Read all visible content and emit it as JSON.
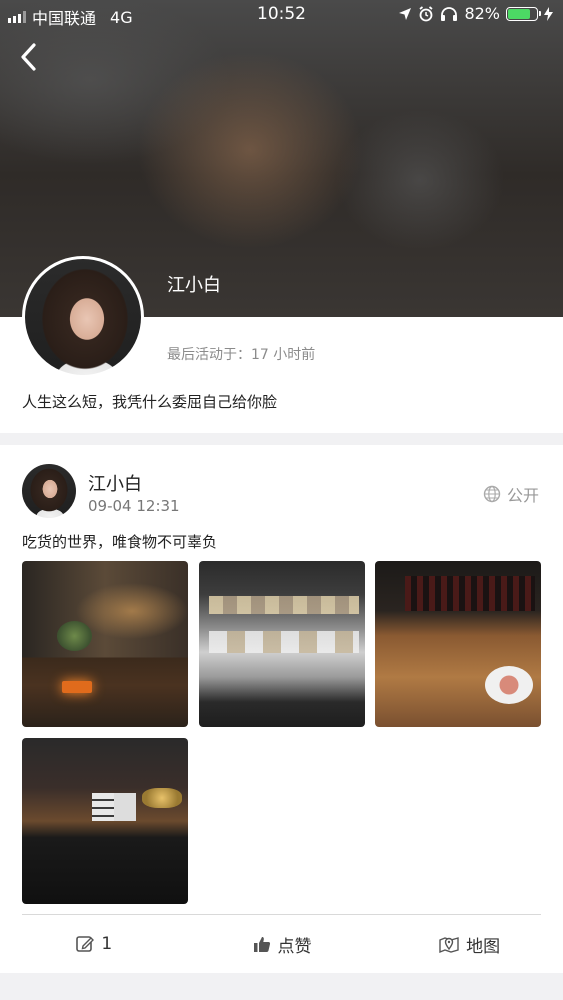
{
  "status_bar": {
    "carrier": "中国联通",
    "network": "4G",
    "time": "10:52",
    "battery_percent_text": "82%",
    "battery_level": 0.82
  },
  "profile": {
    "name": "江小白",
    "last_active": "最后活动于：17 小时前",
    "signature": "人生这么短，我凭什么委屈自己给你脸"
  },
  "post": {
    "author": "江小白",
    "time": "09-04 12:31",
    "visibility": "公开",
    "text": "吃货的世界，唯食物不可辜负",
    "photo_count": 4
  },
  "actions": {
    "comment_count": "1",
    "like_label": "点赞",
    "map_label": "地图"
  },
  "icons": [
    "back-icon",
    "location-arrow-icon",
    "alarm-icon",
    "headphones-icon",
    "charging-icon",
    "globe-icon",
    "comment-edit-icon",
    "thumbs-up-icon",
    "map-pin-icon"
  ],
  "colors": {
    "battery_green": "#4cd964",
    "muted_text": "#8b8b8b",
    "page_bg": "#f1f1f3"
  }
}
